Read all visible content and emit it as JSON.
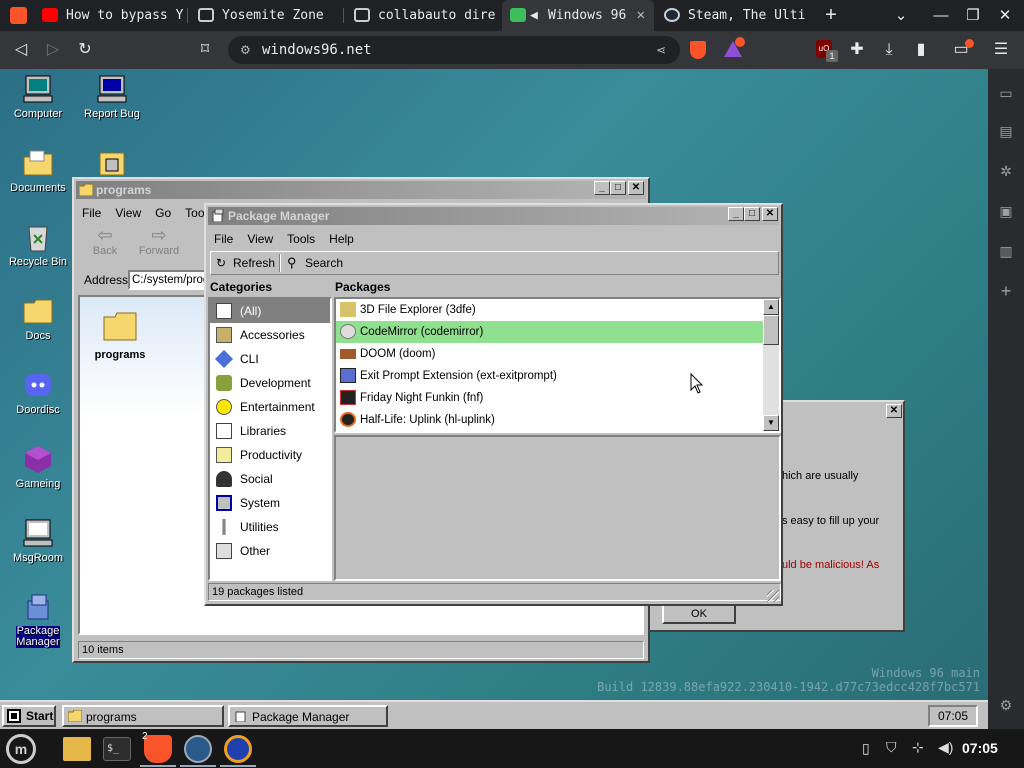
{
  "browser": {
    "tabs": [
      {
        "title": "How to bypass Y",
        "icon_color": "#ff0000"
      },
      {
        "title": "Yosemite Zone",
        "icon_color": "#dddddd"
      },
      {
        "title": "collabauto dire",
        "icon_color": "#dddddd"
      },
      {
        "title": "Windows 96",
        "icon_color": "#3cbf5c"
      },
      {
        "title": "Steam, The Ulti",
        "icon_color": "#dddddd"
      }
    ],
    "url": "windows96.net",
    "ublock_count": "1"
  },
  "desktop": {
    "icons": [
      {
        "label": "Computer"
      },
      {
        "label": "Report Bug"
      },
      {
        "label": "Documents"
      },
      {
        "label": "Recycle Bin"
      },
      {
        "label": "Docs"
      },
      {
        "label": "Doordisc"
      },
      {
        "label": "Gameing"
      },
      {
        "label": "MsgRoom"
      },
      {
        "label": "Package\nManager"
      }
    ],
    "watermark_line1": "Windows 96 main",
    "watermark_line2": "Build 12839.88efa922.230410-1942.d77c73edcc428f7bc571"
  },
  "explorer": {
    "title": "programs",
    "menu": [
      "File",
      "View",
      "Go",
      "Tools"
    ],
    "back_label": "Back",
    "forward_label": "Forward",
    "address_label": "Address",
    "address_value": "C:/system/programs",
    "folder_label": "programs",
    "status": "10 items"
  },
  "dialog": {
    "line1": "hich are usually",
    "line2": "s easy to fill up your",
    "line3": "uld be malicious! As",
    "ok_label": "OK"
  },
  "package_manager": {
    "title": "Package Manager",
    "menu": [
      "File",
      "View",
      "Tools",
      "Help"
    ],
    "refresh_label": "Refresh",
    "search_label": "Search",
    "categories_header": "Categories",
    "packages_header": "Packages",
    "categories": [
      "(All)",
      "Accessories",
      "CLI",
      "Development",
      "Entertainment",
      "Libraries",
      "Productivity",
      "Social",
      "System",
      "Utilities",
      "Other"
    ],
    "packages": [
      "3D File Explorer (3dfe)",
      "CodeMirror (codemirror)",
      "DOOM (doom)",
      "Exit Prompt Extension (ext-exitprompt)",
      "Friday Night Funkin (fnf)",
      "Half-Life: Uplink (hl-uplink)"
    ],
    "status": "19 packages listed"
  },
  "taskbar": {
    "start_label": "Start",
    "tasks": [
      "programs",
      "Package Manager"
    ],
    "clock": "07:05"
  },
  "panel": {
    "clock": "07:05",
    "brave_badge": "2"
  }
}
